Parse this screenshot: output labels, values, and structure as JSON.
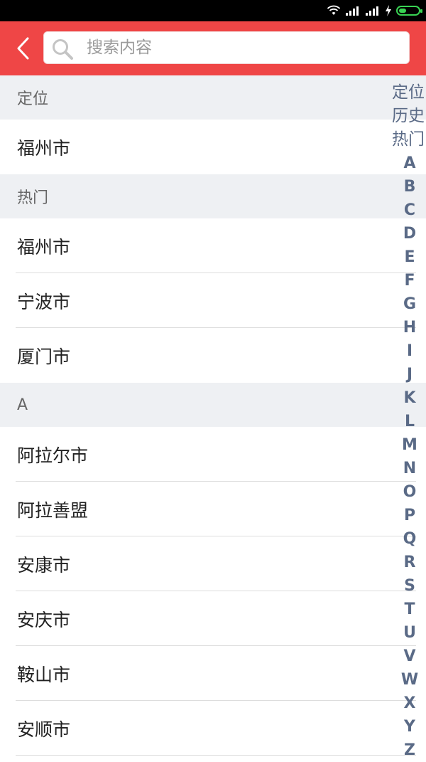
{
  "status_bar": {
    "icons": [
      "wifi-icon",
      "signal-icon",
      "signal-icon",
      "charging-icon",
      "battery-icon"
    ],
    "battery_color": "#39d353"
  },
  "header": {
    "background": "#ef4646",
    "back_icon": "chevron-left-icon",
    "search": {
      "placeholder": "搜索内容",
      "icon": "search-icon"
    }
  },
  "sections": [
    {
      "title": "定位",
      "items": [
        "福州市"
      ]
    },
    {
      "title": "热门",
      "items": [
        "福州市",
        "宁波市",
        "厦门市"
      ]
    },
    {
      "title": "A",
      "items": [
        "阿拉尔市",
        "阿拉善盟",
        "安康市",
        "安庆市",
        "鞍山市",
        "安顺市"
      ]
    }
  ],
  "index_bar": {
    "words": [
      "定位",
      "历史",
      "热门"
    ],
    "letters": [
      "A",
      "B",
      "C",
      "D",
      "E",
      "F",
      "G",
      "H",
      "I",
      "J",
      "K",
      "L",
      "M",
      "N",
      "O",
      "P",
      "Q",
      "R",
      "S",
      "T",
      "U",
      "V",
      "W",
      "X",
      "Y",
      "Z"
    ]
  }
}
